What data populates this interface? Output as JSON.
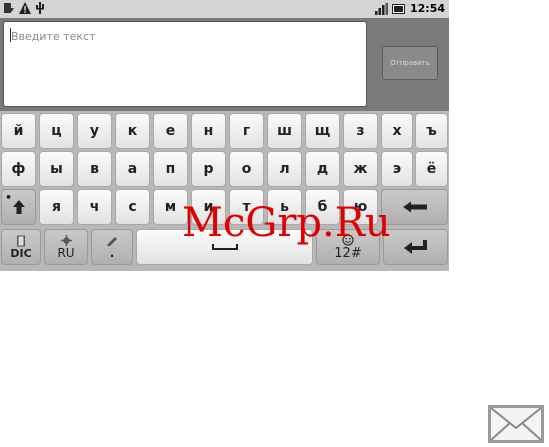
{
  "status_bar": {
    "time": "12:54"
  },
  "composer": {
    "placeholder": "Введите текст",
    "send_label": "Отправить"
  },
  "keyboard": {
    "row1": [
      "й",
      "ц",
      "у",
      "к",
      "е",
      "н",
      "г",
      "ш",
      "щ",
      "з",
      "х",
      "ъ"
    ],
    "row2": [
      "ф",
      "ы",
      "в",
      "а",
      "п",
      "р",
      "о",
      "л",
      "д",
      "ж",
      "э",
      "ё"
    ],
    "row3": [
      "я",
      "ч",
      "с",
      "м",
      "и",
      "т",
      "ь",
      "б",
      "ю"
    ],
    "dic_label": "DIC",
    "lang_label": "RU",
    "period_label": ".",
    "numbers_label": "12#",
    "icons": {
      "shift": "shift-arrow-icon",
      "backspace": "backspace-icon",
      "enter": "enter-icon",
      "space": "space-icon"
    }
  },
  "watermark": "McGrp.Ru",
  "colors": {
    "watermark": "#e00000",
    "keyboard_bg": "#b8b8b8"
  }
}
